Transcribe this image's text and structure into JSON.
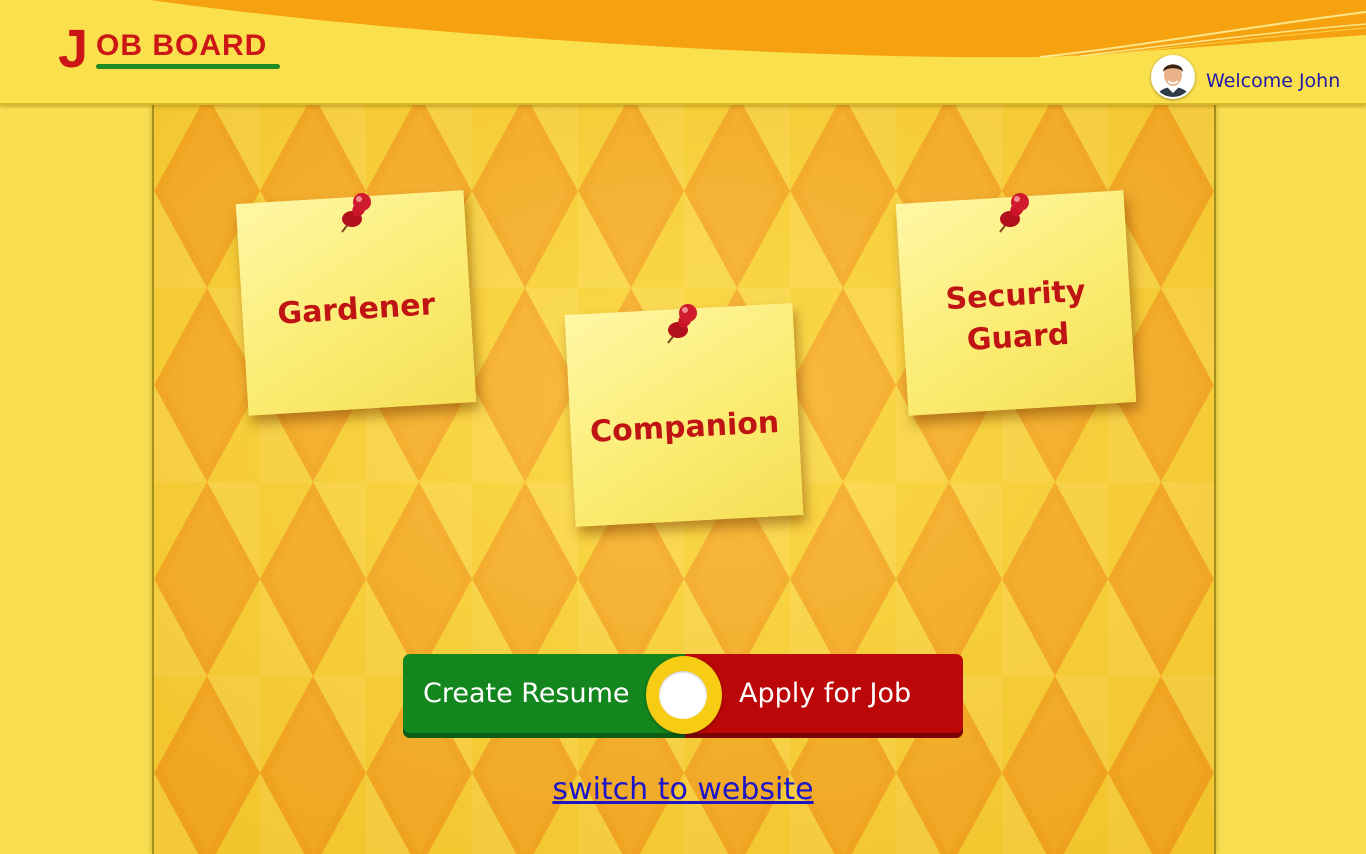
{
  "header": {
    "logo_initial": "J",
    "logo_rest": "OB BOARD",
    "welcome_text": "Welcome John"
  },
  "board": {
    "notes": [
      {
        "label": "Gardener"
      },
      {
        "label": "Companion"
      },
      {
        "label": "Security Guard",
        "label_line1": "Security",
        "label_line2": "Guard"
      }
    ]
  },
  "actions": {
    "create_resume_label": "Create Resume",
    "apply_for_job_label": "Apply for Job"
  },
  "switch_link_text": "switch to website",
  "colors": {
    "background_yellow": "#f9df4f",
    "header_orange": "#f6a10f",
    "diamond_orange": "#f6a722",
    "note_text_red": "#c01313",
    "create_green": "#14861e",
    "apply_red": "#bb0707",
    "link_blue": "#1e15c8",
    "welcome_blue": "#1f1aa8"
  },
  "icons": {
    "pin": "push-pin-icon",
    "avatar": "user-avatar"
  }
}
